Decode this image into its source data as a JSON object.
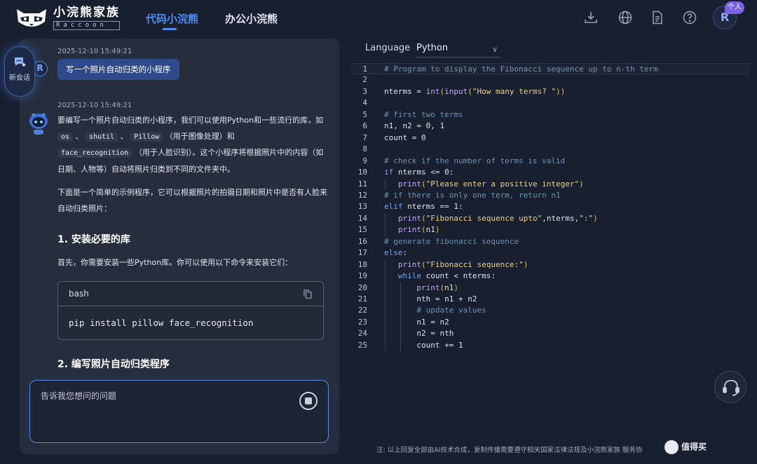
{
  "brand": {
    "name_cn": "小浣熊家族",
    "name_en": "Raccoon"
  },
  "nav": {
    "tabs": [
      {
        "label": "代码小浣熊",
        "active": true
      },
      {
        "label": "办公小浣熊",
        "active": false
      }
    ]
  },
  "header_icons": [
    "download-icon",
    "globe-icon",
    "document-icon",
    "help-icon"
  ],
  "user": {
    "avatar_letter": "R",
    "badge": "个人"
  },
  "sidebar": {
    "new_chat_label": "新会话"
  },
  "chat": {
    "messages": [
      {
        "role": "user",
        "timestamp": "2025-12-10 15:49:21",
        "avatar": "R",
        "text": "写一个照片自动归类的小程序"
      },
      {
        "role": "assistant",
        "timestamp": "2025-12-10 15:49:21",
        "p1": {
          "a": "要编写一个照片自动归类的小程序，我们可以使用Python和一些流行的库，如",
          "code1": "os",
          "sep1": "、",
          "code2": "shutil",
          "sep2": "、",
          "code3": "Pillow",
          "b": "（用于图像处理）和",
          "code4": "face_recognition",
          "c": "（用于人脸识别）。这个小程序将根据照片中的内容（如日期、人物等）自动将照片归类到不同的文件夹中。"
        },
        "p2": "下面是一个简单的示例程序，它可以根据照片的拍摄日期和照片中是否有人脸来自动归类照片：",
        "h1": "1. 安装必要的库",
        "p3": "首先，你需要安装一些Python库。你可以使用以下命令来安装它们：",
        "code_block": {
          "lang": "bash",
          "code": "pip install pillow face_recognition"
        },
        "h2": "2. 编写照片自动归类程序"
      }
    ],
    "input_placeholder": "告诉我您想问的问题"
  },
  "editor": {
    "language_label": "Language",
    "language_value": "Python",
    "lines": [
      "# Program to display the Fibonacci sequence up to n-th term",
      "",
      "nterms = int(input(\"How many terms? \"))",
      "",
      "# first two terms",
      "n1, n2 = 0, 1",
      "count = 0",
      "",
      "# check if the number of terms is valid",
      "if nterms <= 0:",
      "   print(\"Please enter a positive integer\")",
      "# if there is only one term, return n1",
      "elif nterms == 1:",
      "   print(\"Fibonacci sequence upto\",nterms,\":\")",
      "   print(n1)",
      "# generate fibonacci sequence",
      "else:",
      "   print(\"Fibonacci sequence:\")",
      "   while count < nterms:",
      "       print(n1)",
      "       nth = n1 + n2",
      "       # update values",
      "       n1 = n2",
      "       n2 = nth",
      "       count += 1"
    ]
  },
  "footer": {
    "disclaimer": "注: 以上回复全部由AI技术合成，复制传播需要遵守相关国家法律法规及小浣熊家族 服务协",
    "watermark": "值得买"
  },
  "colors": {
    "background": "#181f2f",
    "panel": "#262d3c",
    "accent": "#4f8ef7",
    "badge": "#7b61e8",
    "comment": "#6f93b4",
    "keyword": "#6aa7ff",
    "string": "#e9d08e",
    "builtin": "#c4a6ff"
  }
}
